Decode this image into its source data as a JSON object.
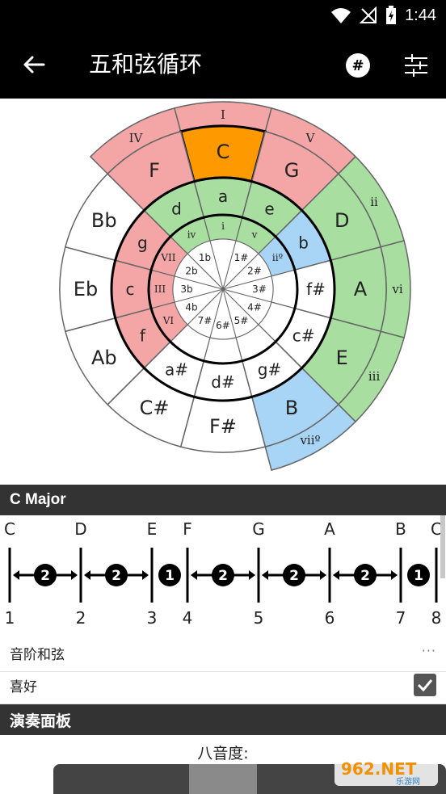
{
  "status": {
    "time": "1:44"
  },
  "header": {
    "title": "五和弦循环",
    "sharp_label": "#"
  },
  "wheel": {
    "outer_major": [
      "C",
      "G",
      "D",
      "A",
      "E",
      "B",
      "F#",
      "C#",
      "Ab",
      "Eb",
      "Bb",
      "F"
    ],
    "middle_minor": [
      "a",
      "e",
      "b",
      "f#",
      "c#",
      "g#",
      "d#",
      "a#",
      "f",
      "c",
      "g",
      "d"
    ],
    "inner_sig": [
      "",
      "1#",
      "2#",
      "3#",
      "4#",
      "5#",
      "6#",
      "7#",
      "4b",
      "3b",
      "2b",
      "1b"
    ],
    "numerals_outer": {
      "I": "I",
      "V": "V",
      "ii": "ii",
      "vi": "vi",
      "iii": "iii",
      "vii": "viiº",
      "IV": "IV"
    },
    "numerals_inner": {
      "i": "i",
      "v": "v",
      "ii": "iiº",
      "VII": "VII",
      "III": "III",
      "VI": "VI",
      "iv": "iv"
    }
  },
  "scale": {
    "title": "C Major",
    "notes": [
      "C",
      "D",
      "E",
      "F",
      "G",
      "A",
      "B",
      "C"
    ],
    "degrees": [
      "1",
      "2",
      "3",
      "4",
      "5",
      "6",
      "7",
      "8"
    ],
    "steps": [
      "2",
      "2",
      "1",
      "2",
      "2",
      "2",
      "1"
    ]
  },
  "rows": {
    "chords_label": "音阶和弦",
    "more_label": "···",
    "favorite_label": "喜好"
  },
  "panel": {
    "title": "演奏面板",
    "octave_label": "八音度:"
  },
  "watermark": {
    "text": "962.NET",
    "sub": "乐游网"
  },
  "colors": {
    "red": "#f4a6a6",
    "orange": "#ff9900",
    "green": "#a8dea0",
    "blue": "#a8d4f5",
    "white": "#ffffff"
  }
}
